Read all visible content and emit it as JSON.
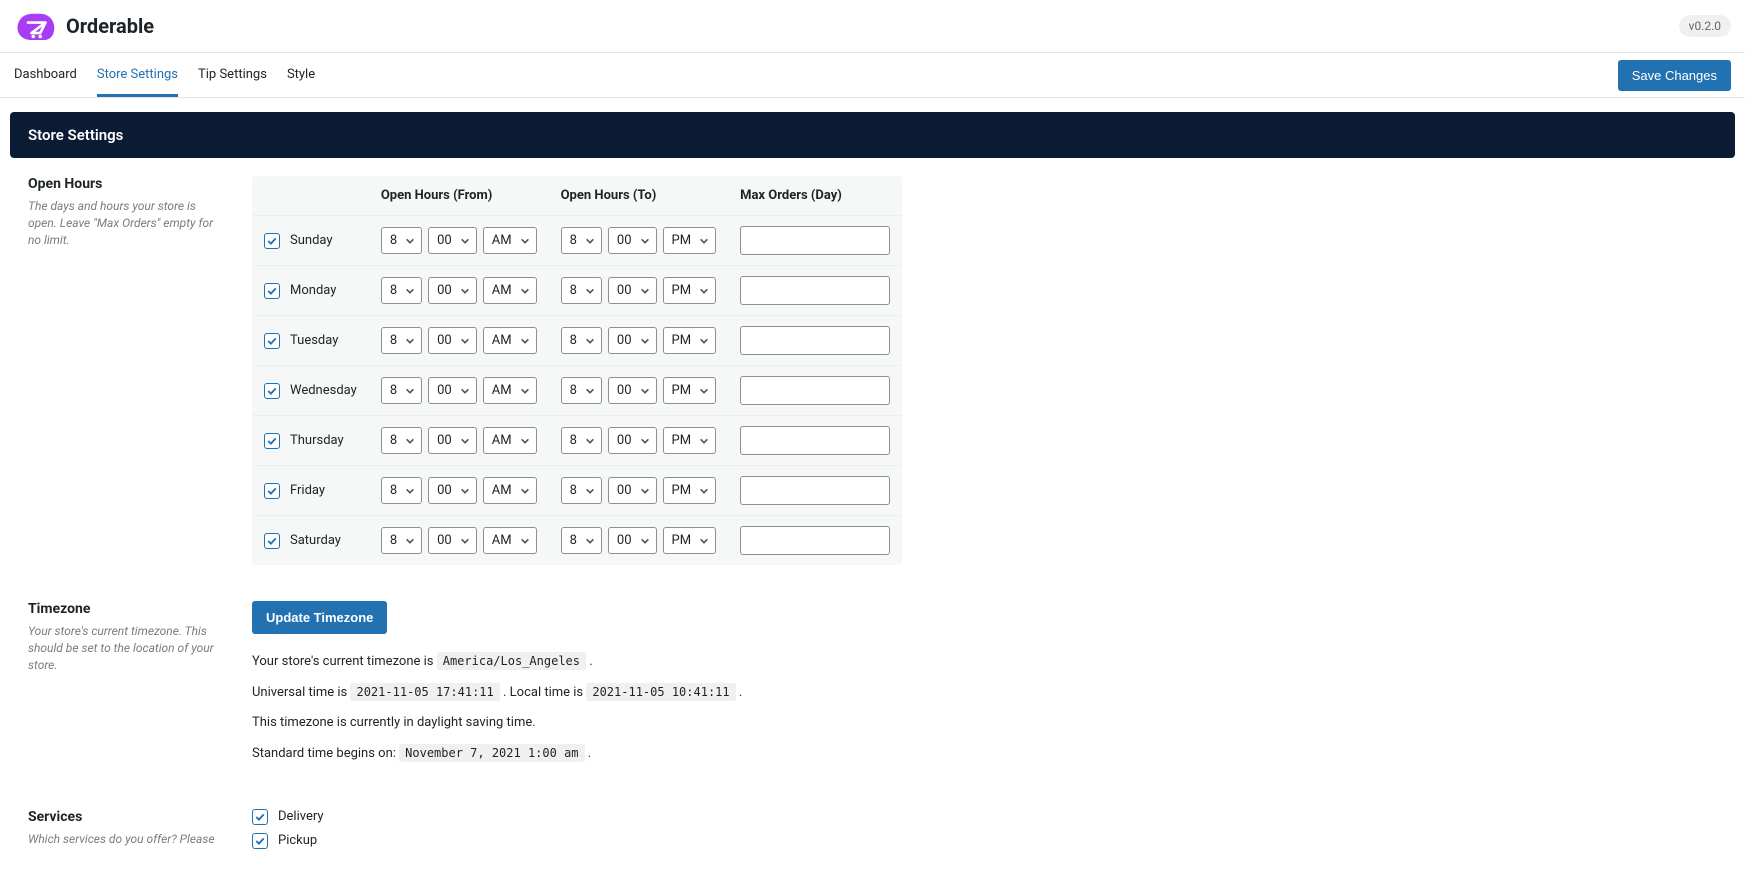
{
  "brand": {
    "name": "Orderable"
  },
  "version": "v0.2.0",
  "nav": {
    "tabs": [
      {
        "label": "Dashboard",
        "active": false
      },
      {
        "label": "Store Settings",
        "active": true
      },
      {
        "label": "Tip Settings",
        "active": false
      },
      {
        "label": "Style",
        "active": false
      }
    ],
    "save_label": "Save Changes"
  },
  "page_title": "Store Settings",
  "open_hours": {
    "label": "Open Hours",
    "desc": "The days and hours your store is open. Leave \"Max Orders\" empty for no limit.",
    "columns": {
      "from": "Open Hours (From)",
      "to": "Open Hours (To)",
      "max": "Max Orders (Day)"
    },
    "rows": [
      {
        "day": "Sunday",
        "checked": true,
        "from_h": "8",
        "from_m": "00",
        "from_ap": "AM",
        "to_h": "8",
        "to_m": "00",
        "to_ap": "PM",
        "max": ""
      },
      {
        "day": "Monday",
        "checked": true,
        "from_h": "8",
        "from_m": "00",
        "from_ap": "AM",
        "to_h": "8",
        "to_m": "00",
        "to_ap": "PM",
        "max": ""
      },
      {
        "day": "Tuesday",
        "checked": true,
        "from_h": "8",
        "from_m": "00",
        "from_ap": "AM",
        "to_h": "8",
        "to_m": "00",
        "to_ap": "PM",
        "max": ""
      },
      {
        "day": "Wednesday",
        "checked": true,
        "from_h": "8",
        "from_m": "00",
        "from_ap": "AM",
        "to_h": "8",
        "to_m": "00",
        "to_ap": "PM",
        "max": ""
      },
      {
        "day": "Thursday",
        "checked": true,
        "from_h": "8",
        "from_m": "00",
        "from_ap": "AM",
        "to_h": "8",
        "to_m": "00",
        "to_ap": "PM",
        "max": ""
      },
      {
        "day": "Friday",
        "checked": true,
        "from_h": "8",
        "from_m": "00",
        "from_ap": "AM",
        "to_h": "8",
        "to_m": "00",
        "to_ap": "PM",
        "max": ""
      },
      {
        "day": "Saturday",
        "checked": true,
        "from_h": "8",
        "from_m": "00",
        "from_ap": "AM",
        "to_h": "8",
        "to_m": "00",
        "to_ap": "PM",
        "max": ""
      }
    ]
  },
  "timezone": {
    "label": "Timezone",
    "desc": "Your store's current timezone. This should be set to the location of your store.",
    "button": "Update Timezone",
    "current_text_prefix": "Your store's current timezone is ",
    "current_tz": "America/Los_Angeles",
    "utc_prefix": "Universal time is ",
    "utc_value": "2021-11-05 17:41:11",
    "local_prefix": ". Local time is ",
    "local_value": "2021-11-05 10:41:11",
    "dst_line": "This timezone is currently in daylight saving time.",
    "std_prefix": "Standard time begins on: ",
    "std_value": "November 7, 2021 1:00 am"
  },
  "services": {
    "label": "Services",
    "desc": "Which services do you offer? Please",
    "items": [
      {
        "label": "Delivery",
        "checked": true
      },
      {
        "label": "Pickup",
        "checked": true
      }
    ]
  }
}
